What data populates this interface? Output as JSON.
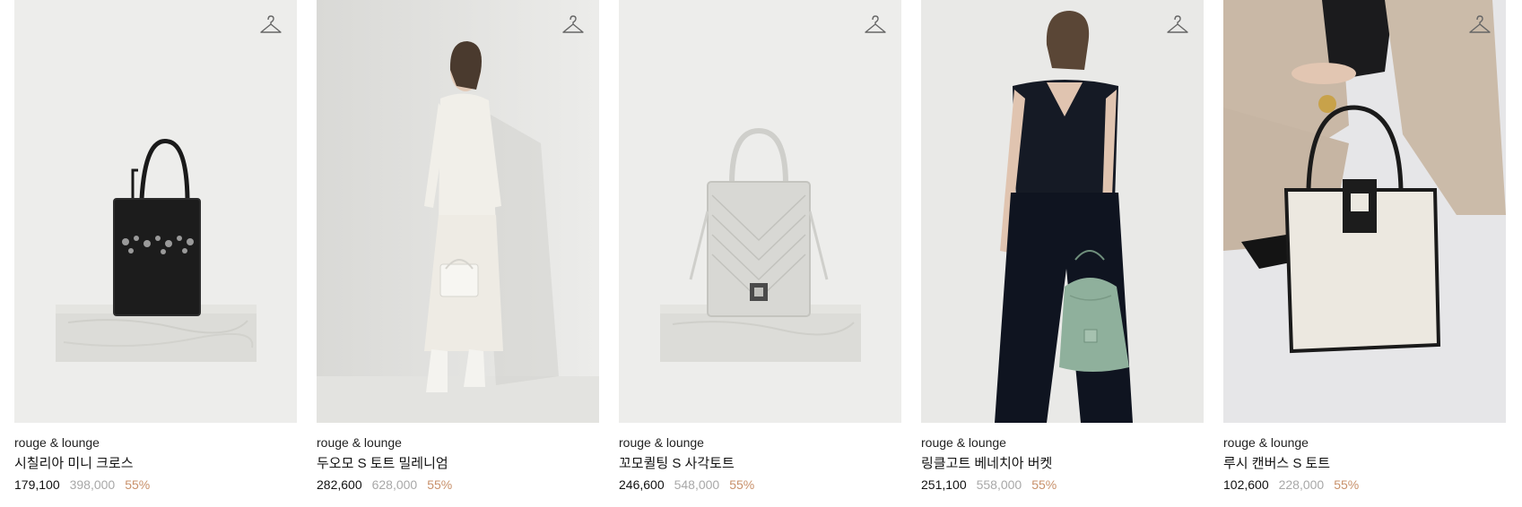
{
  "colors": {
    "discount": "#c8906a",
    "original_price": "#a8a8a8",
    "price": "#111111"
  },
  "products": [
    {
      "brand": "rouge & lounge",
      "name": "시칠리아 미니 크로스",
      "price": "179,100",
      "original_price": "398,000",
      "discount": "55%",
      "icon": "hanger-icon"
    },
    {
      "brand": "rouge & lounge",
      "name": "두오모 S 토트 밀레니엄",
      "price": "282,600",
      "original_price": "628,000",
      "discount": "55%",
      "icon": "hanger-icon"
    },
    {
      "brand": "rouge & lounge",
      "name": "꼬모퀼팅 S 사각토트",
      "price": "246,600",
      "original_price": "548,000",
      "discount": "55%",
      "icon": "hanger-icon"
    },
    {
      "brand": "rouge & lounge",
      "name": "링클고트 베네치아 버켓",
      "price": "251,100",
      "original_price": "558,000",
      "discount": "55%",
      "icon": "hanger-icon"
    },
    {
      "brand": "rouge & lounge",
      "name": "루시 캔버스 S 토트",
      "price": "102,600",
      "original_price": "228,000",
      "discount": "55%",
      "icon": "hanger-icon"
    }
  ]
}
